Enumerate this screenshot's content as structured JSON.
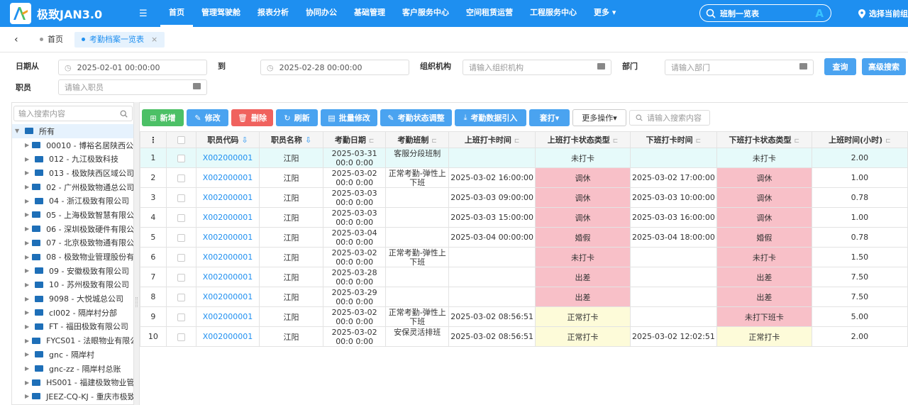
{
  "app": {
    "title": "极致JAN3.0",
    "logo_letter": "A"
  },
  "nav": {
    "items": [
      "首页",
      "管理驾驶舱",
      "报表分析",
      "协同办公",
      "基础管理",
      "客户服务中心",
      "空间租赁运营",
      "工程服务中心",
      "更多 ▾"
    ],
    "active_index": 0
  },
  "top_search": {
    "value": "班制一览表",
    "badge": "A"
  },
  "location": {
    "label": "选择当前组"
  },
  "tabs": {
    "items": [
      "首页",
      "考勤档案一览表"
    ],
    "active_index": 1,
    "close": "×"
  },
  "filters": {
    "date_from_label": "日期从",
    "date_from_value": "2025-02-01 00:00:00",
    "to_label": "到",
    "date_to_value": "2025-02-28 00:00:00",
    "org_label": "组织机构",
    "org_placeholder": "请输入组织机构",
    "dept_label": "部门",
    "dept_placeholder": "请输入部门",
    "staff_label": "职员",
    "staff_placeholder": "请输入职员",
    "query_button": "查询",
    "advanced_button": "高级搜索"
  },
  "tree": {
    "search_placeholder": "输入搜索内容",
    "root": "所有",
    "items": [
      "00010 - 博裕名居陕西公司",
      "012 - 九江极致科技",
      "013 - 极致陕西区域公司",
      "02 - 广州极致物通总公司",
      "04 - 浙江极致有限公司",
      "05 - 上海极致智慧有限公司",
      "06 - 深圳极致硬件有限公司",
      "07 - 北京极致物通有限公司",
      "08 - 极致物业管理股份有限",
      "09 - 安徽极致有限公司",
      "10 - 苏州极致有限公司",
      "9098 - 大悦城总公司",
      "cl002 - 隔岸村分部",
      "FT - 福田极致有限公司",
      "FYCS01 - 法眼物业有限公司",
      "gnc - 隔岸村",
      "gnc-zz - 隔岸村总账",
      "HS001 - 福建极致物业管理",
      "JEEZ-CQ-KJ - 重庆市极致"
    ]
  },
  "toolbar": {
    "add": "新增",
    "edit": "修改",
    "delete": "删除",
    "refresh": "刷新",
    "batch_edit": "批量修改",
    "status_adjust": "考勤状态调整",
    "import": "考勤数据引入",
    "print": "套打▾",
    "more": "更多操作▾",
    "search_placeholder": "请输入搜索内容"
  },
  "grid": {
    "columns": [
      "⋮",
      "",
      "职员代码",
      "职员名称",
      "考勤日期",
      "考勤班制",
      "上班打卡时间",
      "上班打卡状态类型",
      "下班打卡时间",
      "下班打卡状态类型",
      "上班时间(小时)"
    ],
    "rows": [
      {
        "no": "1",
        "code": "X002000001",
        "name": "江阳",
        "date": "2025-03-31 00:0 0:00",
        "shift": "客服分段班制",
        "in_time": "",
        "in_status": "未打卡",
        "out_time": "",
        "out_status": "未打卡",
        "hours": "2.00",
        "in_color": "",
        "out_color": ""
      },
      {
        "no": "2",
        "code": "X002000001",
        "name": "江阳",
        "date": "2025-03-02 00:0 0:00",
        "shift": "正常考勤-弹性上下班",
        "in_time": "2025-03-02 16:00:00",
        "in_status": "调休",
        "out_time": "2025-03-02 17:00:00",
        "out_status": "调休",
        "hours": "1.00",
        "in_color": "pink",
        "out_color": "pink"
      },
      {
        "no": "3",
        "code": "X002000001",
        "name": "江阳",
        "date": "2025-03-03 00:0 0:00",
        "shift": "",
        "in_time": "2025-03-03 09:00:00",
        "in_status": "调休",
        "out_time": "2025-03-03 10:00:00",
        "out_status": "调休",
        "hours": "0.78",
        "in_color": "pink",
        "out_color": "pink"
      },
      {
        "no": "4",
        "code": "X002000001",
        "name": "江阳",
        "date": "2025-03-03 00:0 0:00",
        "shift": "",
        "in_time": "2025-03-03 15:00:00",
        "in_status": "调休",
        "out_time": "2025-03-03 16:00:00",
        "out_status": "调休",
        "hours": "1.00",
        "in_color": "pink",
        "out_color": "pink"
      },
      {
        "no": "5",
        "code": "X002000001",
        "name": "江阳",
        "date": "2025-03-04 00:0 0:00",
        "shift": "",
        "in_time": "2025-03-04 00:00:00",
        "in_status": "婚假",
        "out_time": "2025-03-04 18:00:00",
        "out_status": "婚假",
        "hours": "0.78",
        "in_color": "pink",
        "out_color": "pink"
      },
      {
        "no": "6",
        "code": "X002000001",
        "name": "江阳",
        "date": "2025-03-02 00:0 0:00",
        "shift": "正常考勤-弹性上下班",
        "in_time": "",
        "in_status": "未打卡",
        "out_time": "",
        "out_status": "未打卡",
        "hours": "1.50",
        "in_color": "pink",
        "out_color": "pink"
      },
      {
        "no": "7",
        "code": "X002000001",
        "name": "江阳",
        "date": "2025-03-28 00:0 0:00",
        "shift": "",
        "in_time": "",
        "in_status": "出差",
        "out_time": "",
        "out_status": "出差",
        "hours": "7.50",
        "in_color": "pink",
        "out_color": "pink"
      },
      {
        "no": "8",
        "code": "X002000001",
        "name": "江阳",
        "date": "2025-03-29 00:0 0:00",
        "shift": "",
        "in_time": "",
        "in_status": "出差",
        "out_time": "",
        "out_status": "出差",
        "hours": "7.50",
        "in_color": "pink",
        "out_color": "pink"
      },
      {
        "no": "9",
        "code": "X002000001",
        "name": "江阳",
        "date": "2025-03-02 00:0 0:00",
        "shift": "正常考勤-弹性上下班",
        "in_time": "2025-03-02 08:56:51",
        "in_status": "正常打卡",
        "out_time": "",
        "out_status": "未打下班卡",
        "hours": "5.00",
        "in_color": "yellow",
        "out_color": "pink"
      },
      {
        "no": "10",
        "code": "X002000001",
        "name": "江阳",
        "date": "2025-03-02 00:0 0:00",
        "shift": "安保灵活排班",
        "in_time": "2025-03-02 08:56:51",
        "in_status": "正常打卡",
        "out_time": "2025-03-02 12:02:51",
        "out_status": "正常打卡",
        "hours": "2.00",
        "in_color": "yellow",
        "out_color": "yellow"
      }
    ]
  },
  "colors": {
    "primary": "#1e8ff0",
    "green": "#4cc066",
    "red": "#f0625e",
    "pink": "#f8c0c8",
    "yellow": "#fdfbd9"
  }
}
